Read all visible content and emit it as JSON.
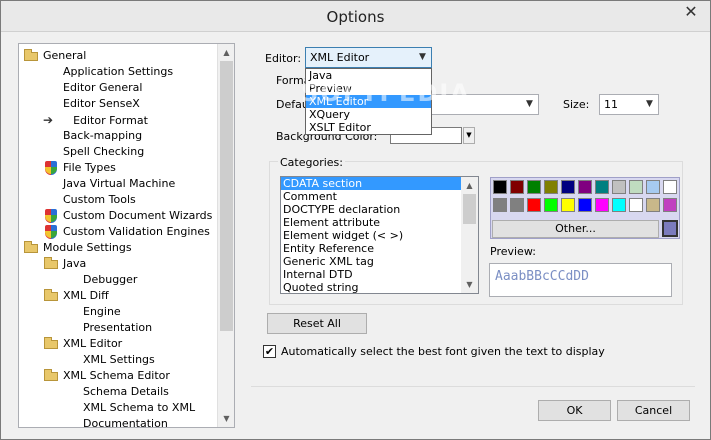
{
  "window": {
    "title": "Options"
  },
  "tree": {
    "items": [
      {
        "label": "General",
        "icon": "folder-icon",
        "indent": 0
      },
      {
        "label": "Application Settings",
        "icon": "",
        "indent": 1
      },
      {
        "label": "Editor General",
        "icon": "",
        "indent": 1
      },
      {
        "label": "Editor SenseX",
        "icon": "",
        "indent": 1
      },
      {
        "label": "Editor Format",
        "icon": "arrow-icon",
        "indent": 1,
        "selected": true
      },
      {
        "label": "Back-mapping",
        "icon": "",
        "indent": 1
      },
      {
        "label": "Spell Checking",
        "icon": "",
        "indent": 1
      },
      {
        "label": "File Types",
        "icon": "shield-icon",
        "indent": 1
      },
      {
        "label": "Java Virtual Machine",
        "icon": "",
        "indent": 1
      },
      {
        "label": "Custom Tools",
        "icon": "",
        "indent": 1
      },
      {
        "label": "Custom Document Wizards",
        "icon": "shield-icon",
        "indent": 1
      },
      {
        "label": "Custom Validation Engines",
        "icon": "shield-icon",
        "indent": 1
      },
      {
        "label": "Module Settings",
        "icon": "folder-icon",
        "indent": 0
      },
      {
        "label": "Java",
        "icon": "folder-icon",
        "indent": 1
      },
      {
        "label": "Debugger",
        "icon": "",
        "indent": 2
      },
      {
        "label": "XML Diff",
        "icon": "folder-icon",
        "indent": 1
      },
      {
        "label": "Engine",
        "icon": "",
        "indent": 2
      },
      {
        "label": "Presentation",
        "icon": "",
        "indent": 2
      },
      {
        "label": "XML Editor",
        "icon": "folder-icon",
        "indent": 1
      },
      {
        "label": "XML Settings",
        "icon": "",
        "indent": 2
      },
      {
        "label": "XML Schema Editor",
        "icon": "folder-icon",
        "indent": 1
      },
      {
        "label": "Schema Details",
        "icon": "",
        "indent": 2
      },
      {
        "label": "XML Schema to XML",
        "icon": "",
        "indent": 2
      },
      {
        "label": "Documentation",
        "icon": "",
        "indent": 2
      }
    ]
  },
  "editor": {
    "label": "Editor:",
    "value": "XML Editor",
    "options": [
      {
        "label": "Java"
      },
      {
        "label": "Preview"
      },
      {
        "label": "XML Editor",
        "selected": true
      },
      {
        "label": "XQuery"
      },
      {
        "label": "XSLT Editor"
      }
    ]
  },
  "format_label": "Format",
  "default_label": "Default",
  "size": {
    "label": "Size:",
    "value": "11"
  },
  "background_color_label": "Background Color:",
  "watermark": "SOFTPEDIA",
  "categories": {
    "label": "Categories:",
    "items": [
      {
        "label": "CDATA section",
        "selected": true
      },
      {
        "label": "Comment"
      },
      {
        "label": "DOCTYPE declaration"
      },
      {
        "label": "Element attribute"
      },
      {
        "label": "Element widget (< >)"
      },
      {
        "label": "Entity Reference"
      },
      {
        "label": "Generic XML tag"
      },
      {
        "label": "Internal DTD"
      },
      {
        "label": "Quoted string"
      }
    ]
  },
  "palette": {
    "colors": [
      "#000000",
      "#800000",
      "#008000",
      "#808000",
      "#000080",
      "#800080",
      "#008080",
      "#c0c0c0",
      "#c0dcc0",
      "#a6caf0",
      "#ffffff",
      "#808080",
      "#808080",
      "#ff0000",
      "#00ff00",
      "#ffff00",
      "#0000ff",
      "#ff00ff",
      "#00ffff",
      "#ffffff",
      "#c8b88a",
      "#c040c0"
    ],
    "other_label": "Other...",
    "selected_color": "#7b7bbd"
  },
  "preview": {
    "label": "Preview:",
    "text": "AaabBBcCCdDD"
  },
  "reset_label": "Reset All",
  "auto_font": {
    "label": "Automatically select the best font given the text to display",
    "checked": true
  },
  "ok_label": "OK",
  "cancel_label": "Cancel"
}
